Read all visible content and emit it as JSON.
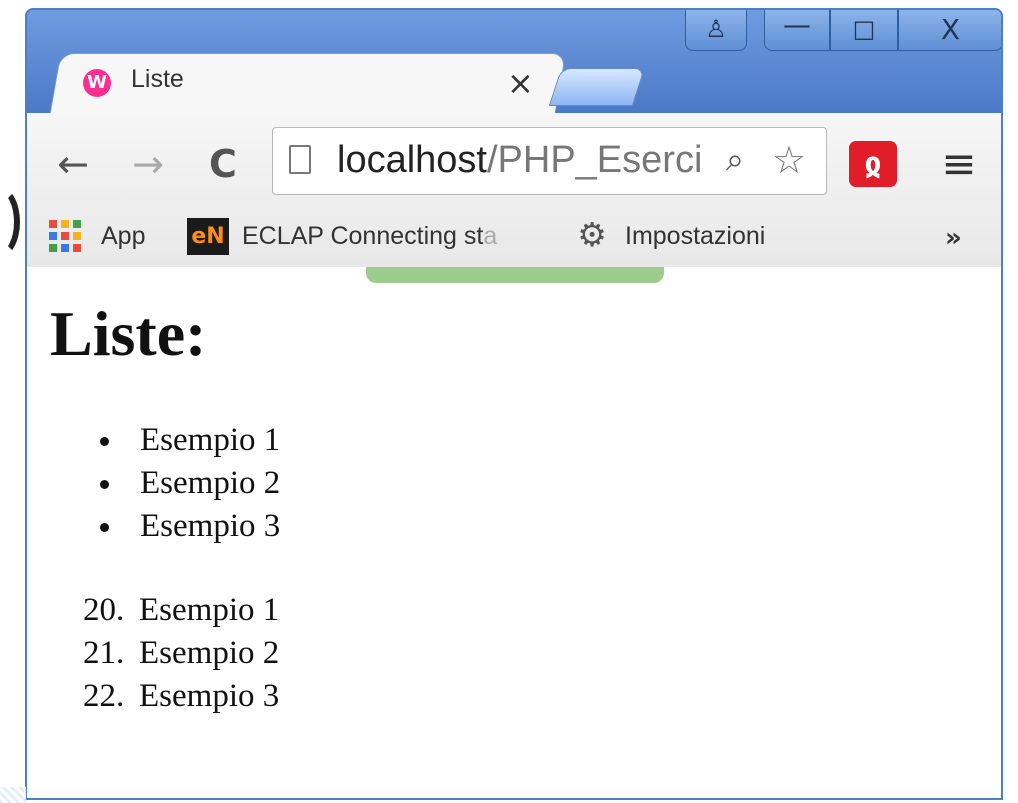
{
  "window": {
    "controls": {
      "user": "♙",
      "minimize": "—",
      "maximize": "□",
      "close": "X"
    }
  },
  "tab": {
    "favicon": "W",
    "title": "Liste",
    "close_label": "×"
  },
  "toolbar": {
    "back": "←",
    "forward": "→",
    "reload": "C",
    "address": {
      "host": "localhost",
      "path": "/PHP_Eserci"
    },
    "search_icon": "⌕",
    "star_icon": "☆",
    "extension_icon": "ჲ",
    "menu_icon": "≡"
  },
  "bookmarks": {
    "apps_label": "App",
    "eclap_icon": "eN",
    "eclap_label_visible": "ECLAP Connecting st",
    "eclap_label_faded": "a",
    "settings_icon": "⚙",
    "settings_label": "Impostazioni",
    "overflow": "»"
  },
  "page": {
    "heading": "Liste:",
    "unordered_items": [
      "Esempio 1",
      "Esempio 2",
      "Esempio 3"
    ],
    "ordered_items": [
      {
        "number": "20.",
        "label": "Esempio 1"
      },
      {
        "number": "21.",
        "label": "Esempio 2"
      },
      {
        "number": "22.",
        "label": "Esempio 3"
      }
    ]
  },
  "colors": {
    "window_frame": "#4d7dc9",
    "favicon": "#ff2d92",
    "avira": "#e11d2a",
    "loading_bar": "#9ccc8d"
  },
  "icons": {
    "left_fragment": "partial-circle-icon",
    "apps": "apps-grid-icon",
    "settings": "gear-icon"
  }
}
